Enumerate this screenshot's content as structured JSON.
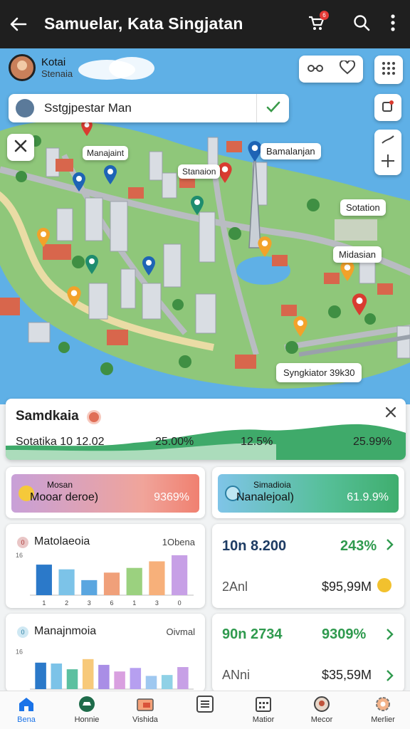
{
  "app": {
    "title": "Samuelar, Kata Singjatan",
    "cart_badge": "6"
  },
  "map": {
    "profile": {
      "name": "Kotai",
      "sub": "Stenaia"
    },
    "search": {
      "value": "Sstgjpestar Man"
    },
    "labels": {
      "l1": "Manajaint",
      "l2": "Bamalanjan",
      "l3": "Stanaion",
      "l4": "Sotation",
      "l5": "Midasian",
      "l6": "Syngkiator 39k30"
    },
    "colors": {
      "water": "#5fb0e6",
      "land": "#8fc77a",
      "pin_red": "#d93b30",
      "pin_blue": "#1e64b5",
      "pin_orange": "#f2a22a",
      "pin_teal": "#1e8c6e"
    }
  },
  "summary": {
    "title": "Samdkaia",
    "label": "Sotatika 10 12.02",
    "v1": "25.00%",
    "v2": "12.5%",
    "v3": "25.99%"
  },
  "stat_pills": [
    {
      "label": "Mosan",
      "value": "Mooar deroe)",
      "number": "9369%",
      "icon": "sun-icon"
    },
    {
      "label": "Simadioia",
      "value": "Nanalejoal)",
      "number": "61.9.9%",
      "icon": "gauge-icon"
    }
  ],
  "chart_cards": [
    {
      "title": "Matolaeoia",
      "right": "1Obena",
      "chart_data": {
        "type": "bar",
        "categories": [
          "1",
          "2",
          "3",
          "6",
          "1",
          "3",
          "0"
        ],
        "values": [
          65,
          55,
          32,
          48,
          58,
          72,
          85
        ],
        "colors": [
          "#2b79c9",
          "#7cc3e8",
          "#5aa6e0",
          "#f0a07a",
          "#9bd17f",
          "#f7b07a",
          "#c7a0e6"
        ],
        "ytick": "16",
        "ylim": [
          0,
          100
        ]
      }
    },
    {
      "title": "Manajnmoia",
      "right": "Oivmal",
      "chart_data": {
        "type": "bar",
        "categories": [
          "",
          "",
          "",
          "",
          "",
          "",
          "",
          "",
          "",
          ""
        ],
        "values": [
          60,
          58,
          45,
          68,
          55,
          40,
          48,
          30,
          32,
          50
        ],
        "colors": [
          "#2b79c9",
          "#7cc3e8",
          "#5bc0a0",
          "#f7c97a",
          "#a98ee6",
          "#d9a0e0",
          "#b69ff0",
          "#9fc8f0",
          "#8fd1e6",
          "#c7a0e6"
        ],
        "ytick": "16",
        "ylim": [
          0,
          100
        ]
      }
    }
  ],
  "kpi_cards": [
    {
      "v1": "10n 8.200",
      "p1": "243%",
      "v2": "2Anl",
      "m": "$95,99M"
    },
    {
      "v1": "90n 2734",
      "p1": "9309%",
      "v2": "ANni",
      "m": "$35,59M"
    }
  ],
  "nav": [
    {
      "label": "Bena",
      "icon": "home-icon",
      "active": true
    },
    {
      "label": "Honnie",
      "icon": "car-icon"
    },
    {
      "label": "Vishida",
      "icon": "folder-icon"
    },
    {
      "label": "",
      "icon": "list-icon"
    },
    {
      "label": "Matior",
      "icon": "calendar-icon"
    },
    {
      "label": "Mecor",
      "icon": "pin-icon"
    },
    {
      "label": "Merlier",
      "icon": "gear-icon"
    }
  ]
}
